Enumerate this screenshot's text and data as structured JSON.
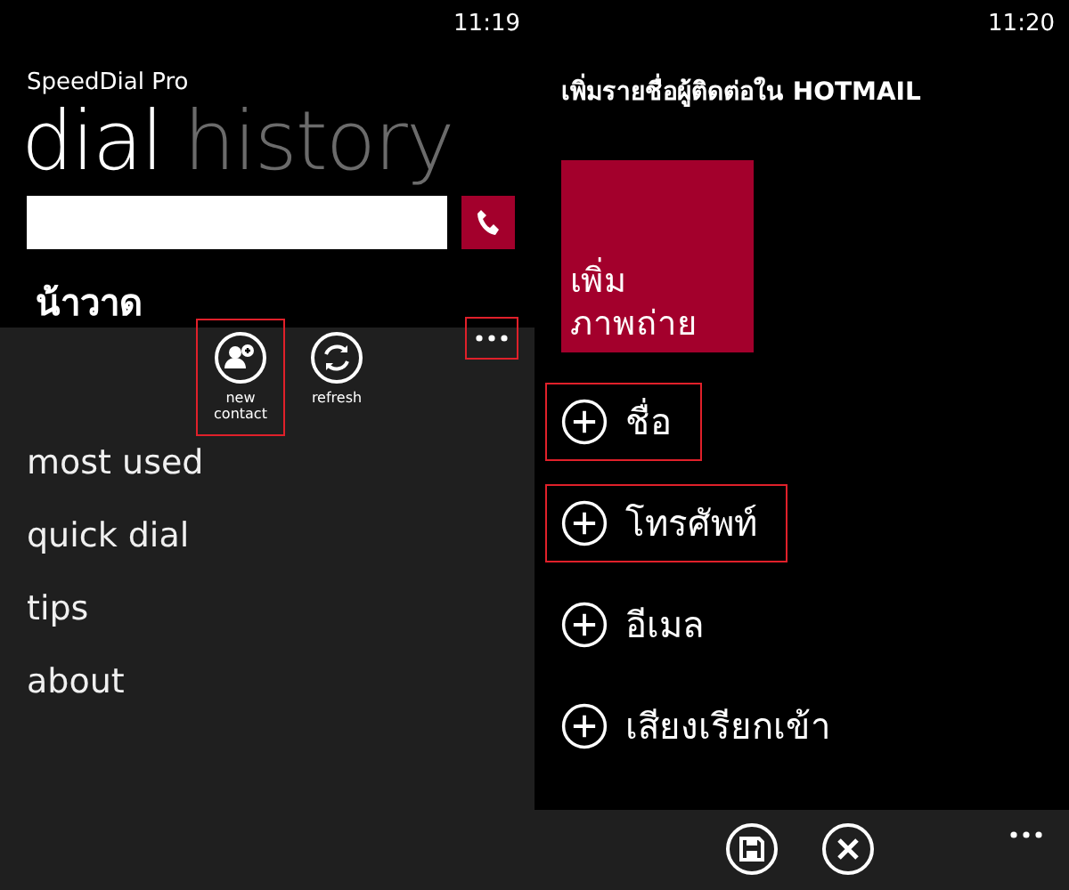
{
  "left_screen": {
    "status_time": "11:19",
    "app_title": "SpeedDial Pro",
    "pivot_headers": [
      {
        "label": "dial",
        "selected": true
      },
      {
        "label": "history",
        "selected": false
      }
    ],
    "contact_name": "น้าวาด",
    "app_bar": {
      "buttons": [
        {
          "kind": "new-contact",
          "label": "new contact",
          "highlighted": true
        },
        {
          "kind": "refresh",
          "label": "refresh",
          "highlighted": false
        }
      ],
      "more_highlighted": true
    },
    "menu_items": [
      "most used",
      "quick dial",
      "tips",
      "about"
    ]
  },
  "right_screen": {
    "status_time": "11:20",
    "title": "เพิ่มรายชื่อผู้ติดต่อใน HOTMAIL",
    "photo_tile": {
      "lines": [
        "เพิ่ม",
        "ภาพถ่าย"
      ]
    },
    "fields": [
      {
        "label": "ชื่อ",
        "highlighted": true
      },
      {
        "label": "โทรศัพท์",
        "highlighted": true
      },
      {
        "label": "อีเมล",
        "highlighted": false
      },
      {
        "label": "เสียงเรียกเข้า",
        "highlighted": false
      }
    ],
    "app_bar": {
      "buttons": [
        {
          "kind": "save"
        },
        {
          "kind": "close"
        }
      ],
      "more_highlighted": false
    }
  }
}
